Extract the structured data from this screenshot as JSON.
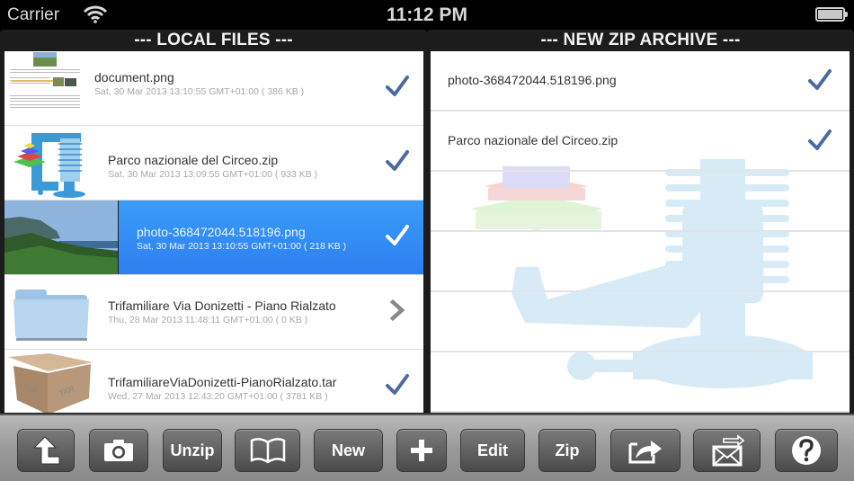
{
  "status_bar": {
    "carrier": "Carrier",
    "time": "11:12 PM",
    "battery": "full"
  },
  "local_files": {
    "title": "--- LOCAL FILES ---",
    "items": [
      {
        "name": "document.png",
        "meta": "Sat, 30 Mar 2013 13:10:55 GMT+01:00 ( 386 KB )",
        "icon": "document-thumbnail",
        "accessory": "checkmark",
        "selected": false
      },
      {
        "name": "Parco nazionale del Circeo.zip",
        "meta": "Sat, 30 Mar 2013 13:09:55 GMT+01:00 ( 933 KB )",
        "icon": "zip-clamp-icon",
        "accessory": "checkmark",
        "selected": false
      },
      {
        "name": "photo-368472044.518196.png",
        "meta": "Sat, 30 Mar 2013 13:10:55 GMT+01:00 ( 218 KB )",
        "icon": "photo-thumbnail",
        "accessory": "checkmark",
        "selected": true
      },
      {
        "name": "Trifamiliare Via Donizetti - Piano Rialzato",
        "meta": "Thu, 28 Mar 2013 11:48:11 GMT+01:00 ( 0 KB )",
        "icon": "folder-icon",
        "accessory": "chevron",
        "selected": false
      },
      {
        "name": "TrifamiliareViaDonizetti-PianoRialzato.tar",
        "meta": "Wed, 27 Mar 2013 12:43:20 GMT+01:00 ( 3781 KB )",
        "icon": "tar-box-icon",
        "accessory": "checkmark",
        "selected": false
      }
    ]
  },
  "new_zip_archive": {
    "title": "--- NEW ZIP ARCHIVE ---",
    "items": [
      {
        "name": "photo-368472044.518196.png",
        "accessory": "checkmark"
      },
      {
        "name": "Parco nazionale del Circeo.zip",
        "accessory": "checkmark"
      }
    ]
  },
  "toolbar": {
    "buttons": [
      {
        "id": "up",
        "icon": "up-arrow-icon",
        "label": ""
      },
      {
        "id": "camera",
        "icon": "camera-icon",
        "label": ""
      },
      {
        "id": "unzip",
        "icon": "",
        "label": "Unzip"
      },
      {
        "id": "book",
        "icon": "book-icon",
        "label": ""
      },
      {
        "id": "new",
        "icon": "",
        "label": "New"
      },
      {
        "id": "add",
        "icon": "plus-icon",
        "label": ""
      },
      {
        "id": "edit",
        "icon": "",
        "label": "Edit"
      },
      {
        "id": "zip",
        "icon": "",
        "label": "Zip"
      },
      {
        "id": "share",
        "icon": "share-icon",
        "label": ""
      },
      {
        "id": "email",
        "icon": "email-send-icon",
        "label": ""
      },
      {
        "id": "help",
        "icon": "help-icon",
        "label": ""
      }
    ]
  },
  "colors": {
    "selection": "#3a9cf8",
    "checkmark": "#4a6aa0",
    "toolbar": "#9a9a9a"
  }
}
